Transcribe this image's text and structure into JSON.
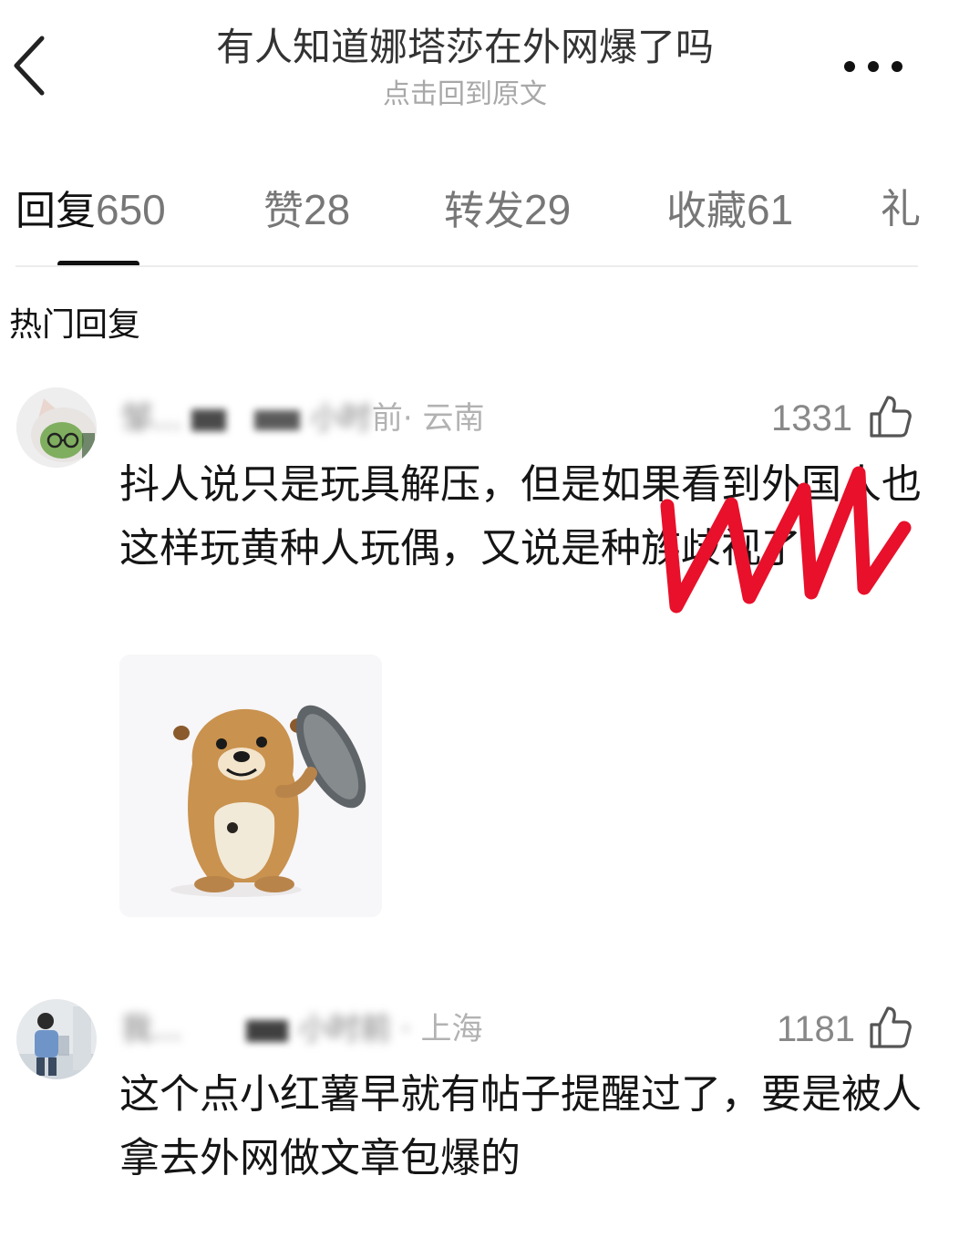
{
  "header": {
    "title": "有人知道娜塔莎在外网爆了吗",
    "subtitle": "点击回到原文",
    "back_icon": "chevron-left-icon",
    "more_icon": "more-dots-icon"
  },
  "tabs": [
    {
      "label": "回复",
      "count": "650",
      "active": true
    },
    {
      "label": "赞",
      "count": "28"
    },
    {
      "label": "转发",
      "count": "29"
    },
    {
      "label": "收藏",
      "count": "61"
    },
    {
      "label": "礼",
      "count": ""
    }
  ],
  "section_title": "热门回复",
  "comments": [
    {
      "user_obscured": "邹...",
      "time_obscured": "小时",
      "time_suffix": "前",
      "location": "· 云南",
      "likes": "1331",
      "text": "抖人说只是玩具解压，但是如果看到外国人也这样玩黄种人玩偶，又说是种族歧视了",
      "has_sticker": true
    },
    {
      "user_obscured": "我...",
      "time_obscured": "小时前 ·",
      "location": "上海",
      "likes": "1181",
      "text": "这个点小红薯早就有帖子提醒过了，要是被人拿去外网做文章包爆的",
      "has_sticker": false
    }
  ],
  "colors": {
    "primary_text": "#151515",
    "secondary_text": "#b2b2b2",
    "scribble": "#e8102a"
  }
}
